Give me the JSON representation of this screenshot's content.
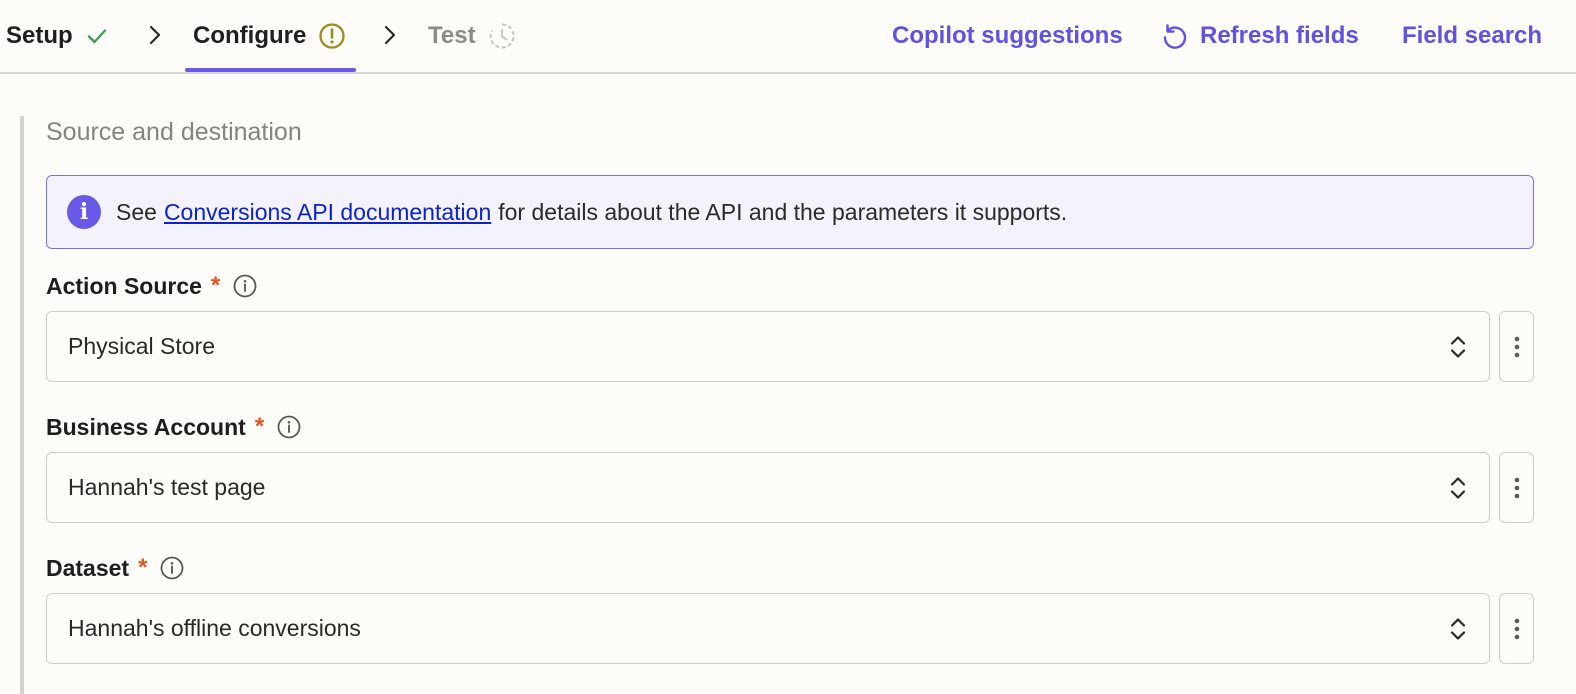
{
  "steps": [
    {
      "label": "Setup",
      "status": "complete",
      "icon": "check-icon"
    },
    {
      "label": "Configure",
      "status": "warning",
      "icon": "warning-circle-icon"
    },
    {
      "label": "Test",
      "status": "pending",
      "icon": "pending-clock-icon"
    }
  ],
  "actions": {
    "copilot": "Copilot suggestions",
    "refresh": "Refresh fields",
    "search": "Field search"
  },
  "section": {
    "title": "Source and destination"
  },
  "info": {
    "prefix": "See",
    "link": "Conversions API documentation",
    "suffix": "for details about the API and the parameters it supports."
  },
  "fields": [
    {
      "label": "Action Source",
      "required_mark": "*",
      "value": "Physical Store"
    },
    {
      "label": "Business Account",
      "required_mark": "*",
      "value": "Hannah's test page"
    },
    {
      "label": "Dataset",
      "required_mark": "*",
      "value": "Hannah's offline conversions"
    }
  ],
  "colors": {
    "accent": "#5f52e0",
    "success": "#3f9e5a",
    "warning": "#a08a22",
    "required": "#e0541c"
  }
}
